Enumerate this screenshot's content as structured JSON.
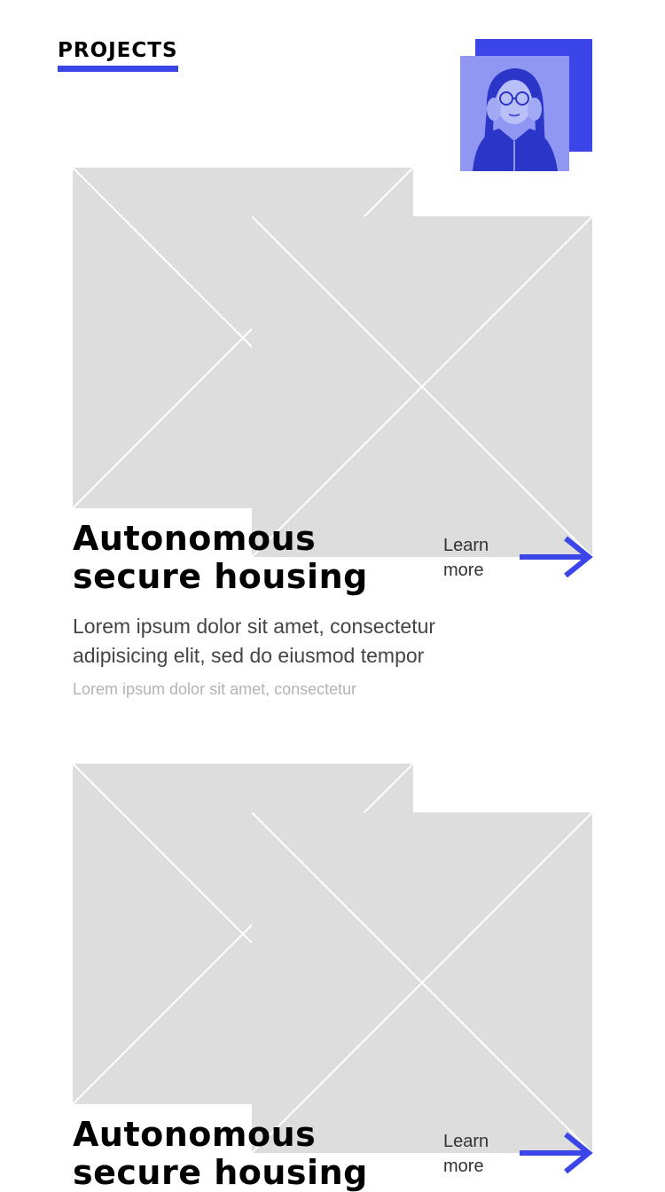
{
  "header": {
    "title": "PROJECTS"
  },
  "colors": {
    "accent": "#3b45e8",
    "placeholder": "#dddddd"
  },
  "avatar": {
    "icon": "profile-photo"
  },
  "projects": [
    {
      "title_line1": "Autonomous",
      "title_line2": "secure housing",
      "learn_more_line1": "Learn",
      "learn_more_line2": "more",
      "description": "Lorem ipsum dolor sit amet, consectetur adipisicing elit, sed do eiusmod tempor",
      "subtext": "Lorem ipsum dolor sit amet, consectetur",
      "icon": "arrow-right-icon"
    },
    {
      "title_line1": "Autonomous",
      "title_line2": "secure housing",
      "learn_more_line1": "Learn",
      "learn_more_line2": "more",
      "icon": "arrow-right-icon"
    }
  ]
}
